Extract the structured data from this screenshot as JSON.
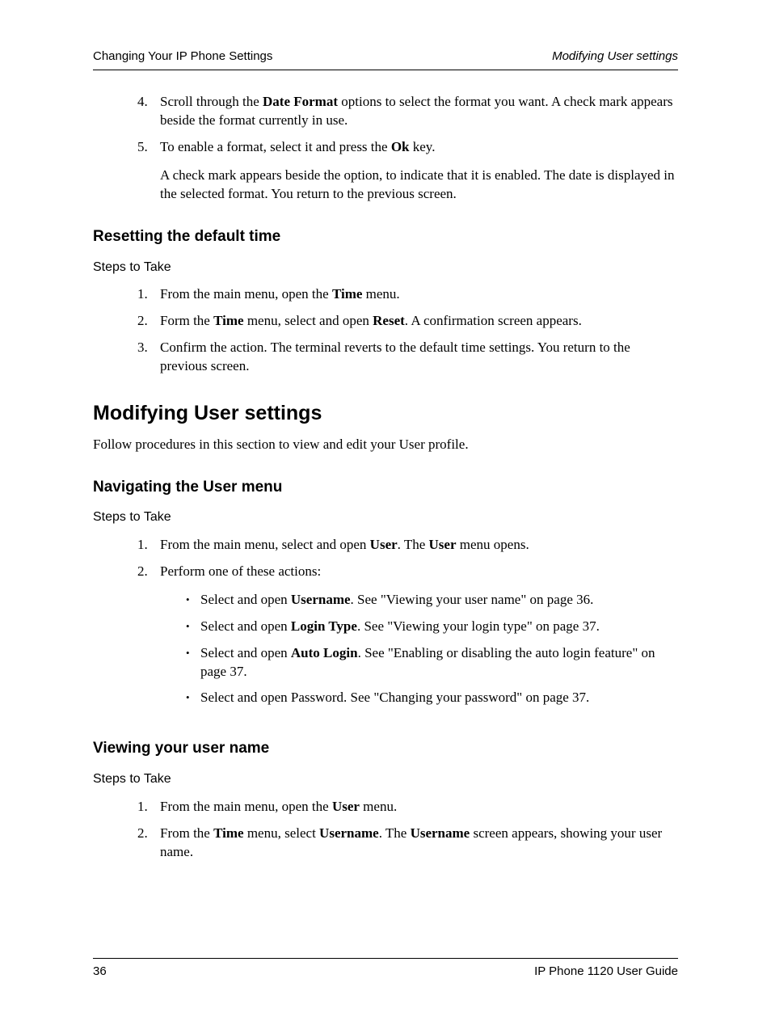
{
  "header": {
    "left": "Changing Your IP Phone Settings",
    "right": "Modifying User settings"
  },
  "footer": {
    "page": "36",
    "title": "IP Phone 1120 User Guide"
  },
  "top_steps": {
    "item4": {
      "num": "4.",
      "pre": "Scroll through the ",
      "bold1": "Date Format",
      "post": " options to select the format you want. A check mark appears beside the format currently in use."
    },
    "item5": {
      "num": "5.",
      "pre": "To enable a format, select it and press the ",
      "bold1": "Ok",
      "post": " key.",
      "para2": "A check mark appears beside the option, to indicate that it is enabled. The date is displayed in the selected format. You return to the previous screen."
    }
  },
  "reset": {
    "title": "Resetting the default time",
    "steps_label": "Steps to Take",
    "s1": {
      "num": "1.",
      "pre": "From the main menu, open the ",
      "b1": "Time",
      "post": " menu."
    },
    "s2": {
      "num": "2.",
      "pre": "Form the ",
      "b1": "Time",
      "mid": " menu, select and open ",
      "b2": "Reset",
      "post": ". A confirmation screen appears."
    },
    "s3": {
      "num": "3.",
      "text": "Confirm the action. The terminal reverts to the default time settings. You return to the previous screen."
    }
  },
  "modify": {
    "title": "Modifying User settings",
    "intro": "Follow procedures in this section to view and edit your User profile."
  },
  "nav": {
    "title": "Navigating the User menu",
    "steps_label": "Steps to Take",
    "s1": {
      "num": "1.",
      "pre": "From the main menu, select and open ",
      "b1": "User",
      "mid": ". The ",
      "b2": "User",
      "post": " menu opens."
    },
    "s2": {
      "num": "2.",
      "text": "Perform one of these actions:",
      "b1": {
        "pre": "Select and open ",
        "bold": "Username",
        "post": ". See \"Viewing your user name\" on page 36."
      },
      "b2": {
        "pre": "Select and open ",
        "bold": "Login Type",
        "post": ". See \"Viewing your login type\" on page 37."
      },
      "b3": {
        "pre": "Select and open ",
        "bold": "Auto Login",
        "post": ". See \"Enabling or disabling the auto login feature\" on page 37."
      },
      "b4": {
        "text": "Select and open Password. See \"Changing your password\" on page 37."
      }
    }
  },
  "view": {
    "title": "Viewing your user name",
    "steps_label": "Steps to Take",
    "s1": {
      "num": "1.",
      "pre": "From the main menu, open the ",
      "b1": "User",
      "post": " menu."
    },
    "s2": {
      "num": "2.",
      "pre": "From the ",
      "b1": "Time",
      "mid1": " menu, select ",
      "b2": "Username",
      "mid2": ". The ",
      "b3": "Username",
      "post": " screen appears, showing your user name."
    }
  }
}
